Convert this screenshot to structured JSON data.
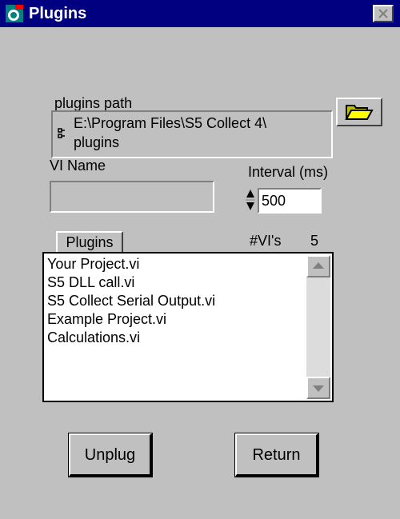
{
  "window": {
    "title": "Plugins",
    "close_glyph": "✕",
    "app_icon": "labview-app-icon"
  },
  "plugins_path": {
    "label": "plugins path",
    "line1": "E:\\Program Files\\S5 Collect 4\\",
    "line2": "plugins",
    "browse_icon": "folder-open-icon"
  },
  "vi_name": {
    "label": "VI Name",
    "value": ""
  },
  "interval": {
    "label": "Interval (ms)",
    "value": "500"
  },
  "plugins_list": {
    "button_label": "Plugins",
    "count_label": "#VI's",
    "count_value": "5",
    "items": [
      "Your Project.vi",
      "S5 DLL call.vi",
      "S5 Collect Serial Output.vi",
      "Example Project.vi",
      "Calculations.vi"
    ]
  },
  "actions": {
    "unplug_label": "Unplug",
    "return_label": "Return"
  }
}
